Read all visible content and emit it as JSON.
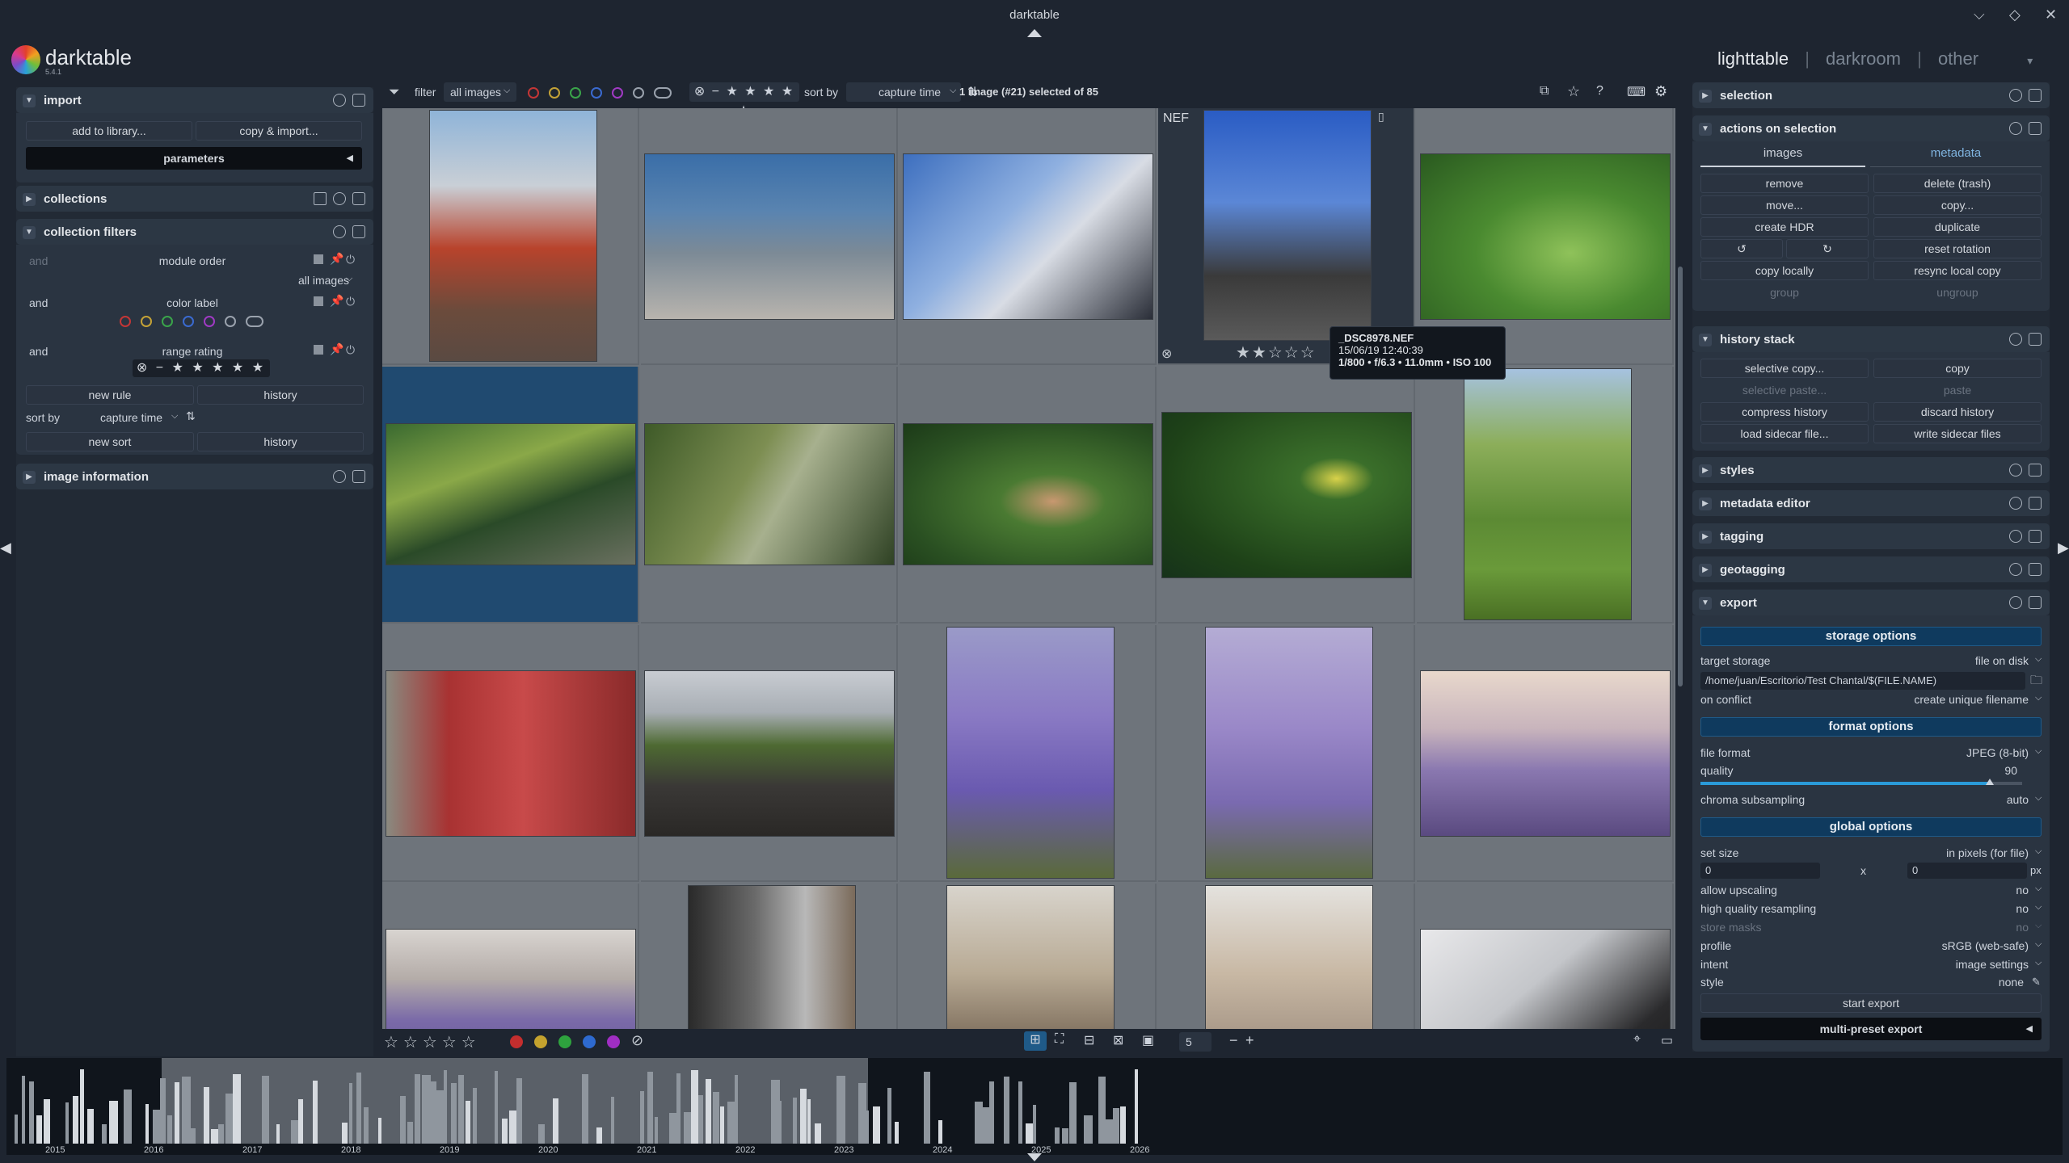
{
  "window": {
    "title": "darktable"
  },
  "brand": {
    "name": "darktable",
    "version": "5.4.1"
  },
  "views": {
    "lighttable": "lighttable",
    "darkroom": "darkroom",
    "other": "other",
    "sep": "|"
  },
  "top_toolbar": {
    "filter_label": "filter",
    "filter_value": "all images",
    "sort_label": "sort by",
    "sort_value": "capture time",
    "selection_status": "1 image (#21) selected of 85"
  },
  "left_panel": {
    "import": {
      "title": "import",
      "add_to_library": "add to library...",
      "copy_import": "copy & import...",
      "parameters": "parameters"
    },
    "collections": {
      "title": "collections"
    },
    "collection_filters": {
      "title": "collection filters",
      "rules": [
        {
          "op": "and",
          "name": "module order",
          "value": "all images"
        },
        {
          "op": "and",
          "name": "color label"
        },
        {
          "op": "and",
          "name": "range rating"
        }
      ],
      "new_rule": "new rule",
      "history": "history",
      "sort_label": "sort by",
      "sort_value": "capture time",
      "new_sort": "new sort",
      "sort_history": "history"
    },
    "image_information": {
      "title": "image information"
    }
  },
  "right_panel": {
    "selection": {
      "title": "selection"
    },
    "actions": {
      "title": "actions on selection",
      "tab_images": "images",
      "tab_metadata": "metadata",
      "remove": "remove",
      "delete": "delete (trash)",
      "move": "move...",
      "copy": "copy...",
      "create_hdr": "create HDR",
      "duplicate": "duplicate",
      "reset_rotation": "reset rotation",
      "copy_locally": "copy locally",
      "resync": "resync local copy",
      "group": "group",
      "ungroup": "ungroup"
    },
    "history_stack": {
      "title": "history stack",
      "selective_copy": "selective copy...",
      "copy": "copy",
      "selective_paste": "selective paste...",
      "paste": "paste",
      "compress": "compress history",
      "discard": "discard history",
      "load_sidecar": "load sidecar file...",
      "write_sidecar": "write sidecar files"
    },
    "styles": {
      "title": "styles"
    },
    "metadata_editor": {
      "title": "metadata editor"
    },
    "tagging": {
      "title": "tagging"
    },
    "geotagging": {
      "title": "geotagging"
    },
    "export": {
      "title": "export",
      "storage_options": "storage options",
      "target_storage_label": "target storage",
      "target_storage_value": "file on disk",
      "path": "/home/juan/Escritorio/Test Chantal/$(FILE.NAME)",
      "on_conflict_label": "on conflict",
      "on_conflict_value": "create unique filename",
      "format_options": "format options",
      "file_format_label": "file format",
      "file_format_value": "JPEG (8-bit)",
      "quality_label": "quality",
      "quality_value": "90",
      "quality_fraction": 0.9,
      "chroma_label": "chroma subsampling",
      "chroma_value": "auto",
      "global_options": "global options",
      "set_size_label": "set size",
      "set_size_value": "in pixels (for file)",
      "width": "0",
      "x": "x",
      "height": "0",
      "px": "px",
      "upscaling_label": "allow upscaling",
      "upscaling_value": "no",
      "hq_label": "high quality resampling",
      "hq_value": "no",
      "masks_label": "store masks",
      "masks_value": "no",
      "profile_label": "profile",
      "profile_value": "sRGB (web-safe)",
      "intent_label": "intent",
      "intent_value": "image settings",
      "style_label": "style",
      "style_value": "none",
      "start_export": "start export",
      "multi_preset": "multi-preset export"
    }
  },
  "tooltip": {
    "badge": "NEF",
    "filename": "_DSC8978.NEF",
    "datetime": "15/06/19 12:40:39",
    "exif": "1/800 • f/6.3 • 11.0mm • ISO 100"
  },
  "bottom_toolbar": {
    "zoom": "5",
    "minus": "−",
    "plus": "+"
  },
  "filmstrip": {
    "years": [
      "2015",
      "2016",
      "2017",
      "2018",
      "2019",
      "2020",
      "2021",
      "2022",
      "2023",
      "2024",
      "2025",
      "2026"
    ]
  },
  "colors": {
    "selection": "#204a70",
    "accent": "#0f3a5e"
  }
}
